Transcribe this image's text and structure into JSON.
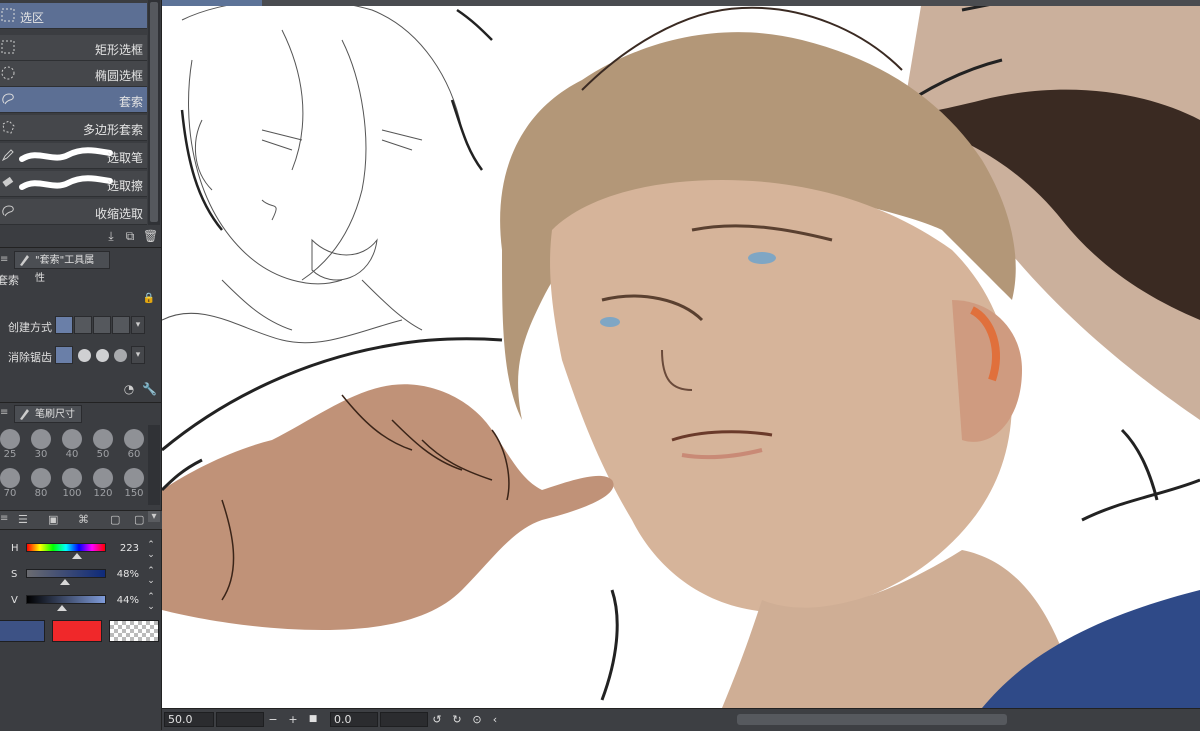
{
  "sub_tool": {
    "title": "选区",
    "items": [
      {
        "label": "矩形选框",
        "icon": "rect-select-icon",
        "active": false
      },
      {
        "label": "椭圆选框",
        "icon": "ellipse-select-icon",
        "active": false
      },
      {
        "label": "套索",
        "icon": "lasso-icon",
        "active": true
      },
      {
        "label": "多边形套索",
        "icon": "polyline-lasso-icon",
        "active": false
      },
      {
        "label": "选取笔",
        "icon": "selection-pen-icon",
        "active": false
      },
      {
        "label": "选取擦",
        "icon": "selection-eraser-icon",
        "active": false
      },
      {
        "label": "收缩选取",
        "icon": "shrink-select-icon",
        "active": false
      }
    ]
  },
  "tool_property": {
    "tab_label": "\"套索\"工具属性",
    "tool_name": "套索",
    "create_mode_label": "创建方式",
    "antialias_label": "消除锯齿"
  },
  "brush_size": {
    "tab_label": "笔刷尺寸",
    "sizes": [
      "25",
      "30",
      "40",
      "50",
      "60",
      "70",
      "80",
      "100",
      "120",
      "150"
    ]
  },
  "color_slider": {
    "h_label": "H",
    "h_value": "223",
    "s_label": "S",
    "s_value": "48%",
    "v_label": "V",
    "v_value": "44%",
    "main_color": "#3d5285",
    "sub_color": "#f0282a"
  },
  "status_bar": {
    "zoom": "50.0",
    "rotation": "0.0",
    "zoom_out": "−",
    "zoom_in": "+"
  }
}
